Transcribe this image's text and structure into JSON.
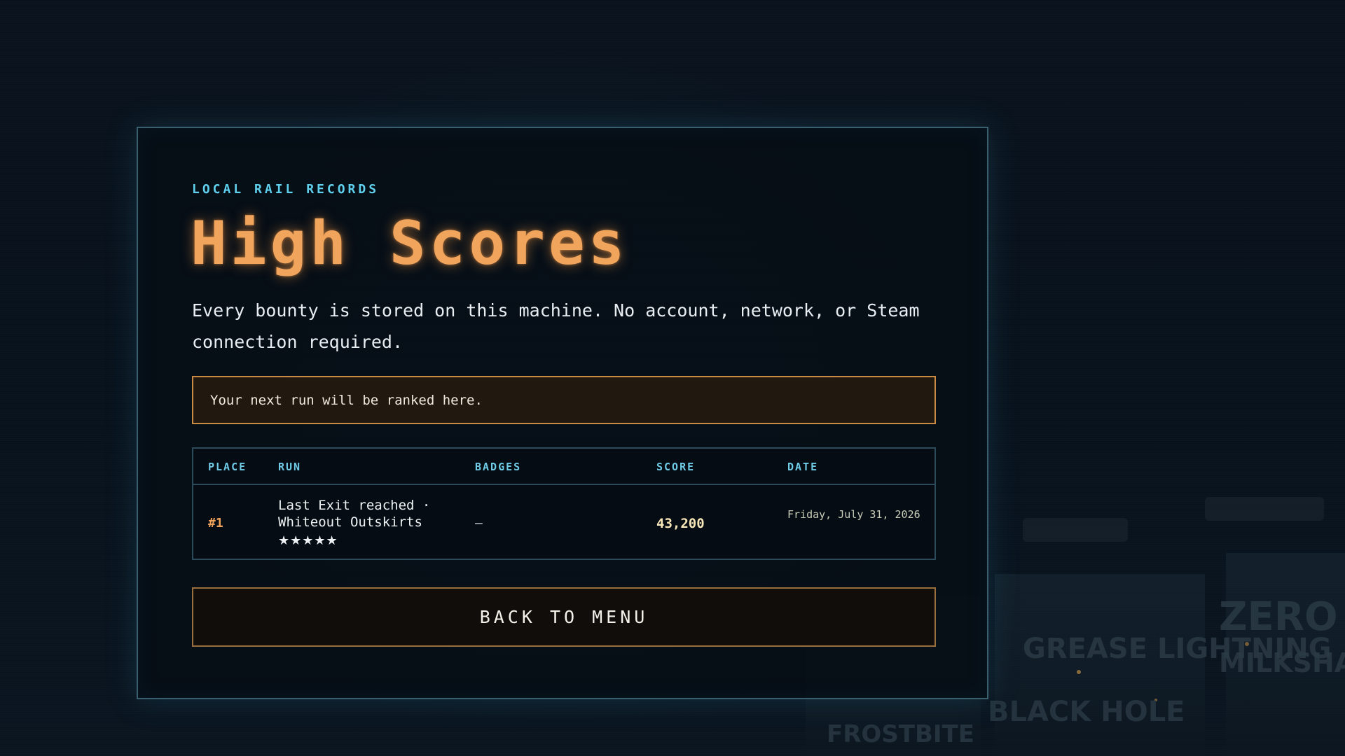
{
  "screen": {
    "eyebrow": "LOCAL RAIL RECORDS",
    "title": "High Scores",
    "subtitle": "Every bounty is stored on this machine. No account, network, or Steam connection required.",
    "notice": "Your next run will be ranked here."
  },
  "table": {
    "headers": {
      "place": "PLACE",
      "run": "RUN",
      "badges": "BADGES",
      "score": "SCORE",
      "date": "DATE"
    },
    "rows": [
      {
        "place": "#1",
        "run": "Last Exit reached · Whiteout Outskirts",
        "stars": "★★★★★",
        "badges": "—",
        "score": "43,200",
        "date": "Friday, July 31, 2026"
      }
    ]
  },
  "actions": {
    "back_label": "BACK TO MENU"
  },
  "background": {
    "signs": [
      "FROSTBITE",
      "BLACK HOLE",
      "GREASE LIGHTNING",
      "ZERO G",
      "MILKSHAKES"
    ]
  },
  "colors": {
    "accent_orange": "#f0a45c",
    "accent_cyan": "#5fd0ee",
    "panel_border": "#3a5f6e",
    "notice_border": "#c98a44"
  }
}
